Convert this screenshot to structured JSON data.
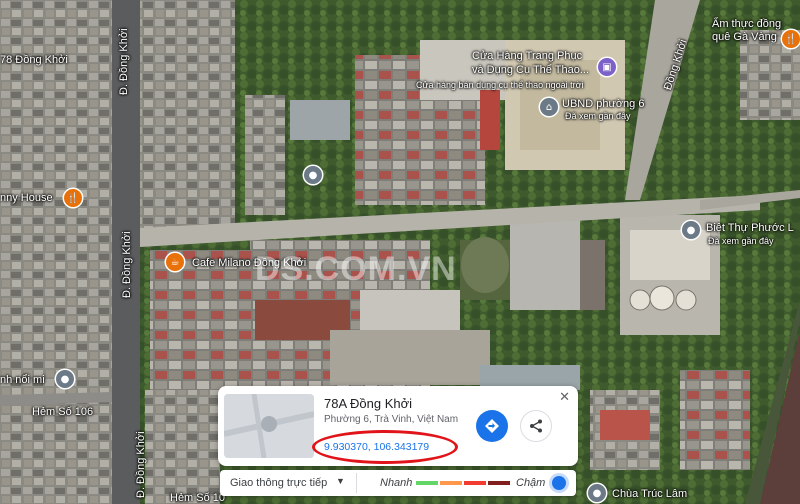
{
  "place_labels": {
    "street_78_dong_khoi": "78 Đồng Khởi",
    "road_d_dong_khoi_top": "Đ. Đồng Khởi",
    "road_d_dong_khoi_mid": "Đ. Đồng Khởi",
    "road_d_dong_khoi_bottom": "Đ. Đồng Khởi",
    "road_dong_khoi_right": "Đồng Khởi",
    "am_thuc_line1": "Ẩm thực đồng",
    "am_thuc_line2": "quê Gà Vàng",
    "sport_store_line1": "Cửa Hàng Trang Phục",
    "sport_store_line2": "và Dụng Cụ Thể Thao...",
    "sport_store_line3": "Cửa hàng bán dụng cụ thể thao ngoài trời",
    "ubnd": "UBND phường 6",
    "ubnd_sub": "Đã xem gần đây",
    "nny_house": "nny House",
    "cafe_milano": "Cafe Milano Đồng Khởi",
    "biet_thu_line1": "Biệt Thự Phước L",
    "biet_thu_sub": "Đã xem gần đây",
    "nh_noi": "nh nổi mi",
    "hem_106_left": "Hẻm Số 106",
    "hem_106_bottom": "Hẻm Số 10",
    "chua_truc_lam": "Chùa Trúc Lâm"
  },
  "watermark": "DS.COM.VN",
  "info_card": {
    "title": "78A Đồng Khởi",
    "address": "Phường 6, Trà Vinh, Việt Nam",
    "coordinates": "9.930370, 106.343179",
    "close_symbol": "✕"
  },
  "traffic_bar": {
    "label": "Giao thông trực tiếp",
    "caret": "▼",
    "fast": "Nhanh",
    "slow": "Chậm",
    "legend_colors": [
      "#63d668",
      "#ff974d",
      "#f23c32",
      "#811f1f"
    ]
  },
  "colors": {
    "accent": "#1a73e8",
    "annotation_circle": "#e0141a"
  },
  "icons": {
    "poi_generic": "place-icon",
    "restaurant": "fork-knife-icon",
    "cafe": "cup-icon",
    "shopping": "shopping-bag-icon",
    "government": "building-icon",
    "directions": "directions-icon",
    "share": "share-icon"
  }
}
